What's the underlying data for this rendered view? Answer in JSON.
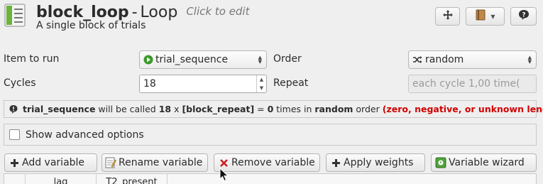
{
  "header": {
    "item_name": "block_loop",
    "separator": "-",
    "item_type": "Loop",
    "edit_hint": "Click to edit",
    "description": "A single block of trials"
  },
  "form": {
    "item_to_run_label": "Item to run",
    "item_to_run_value": "trial_sequence",
    "order_label": "Order",
    "order_value": "random",
    "cycles_label": "Cycles",
    "cycles_value": "18",
    "repeat_label": "Repeat",
    "repeat_value": "each cycle 1,00 time("
  },
  "info": {
    "item": "trial_sequence",
    "text1": " will be called ",
    "cycles": "18",
    "text2": " x ",
    "repeat_var": "[block_repeat]",
    "text3": " = ",
    "total": "0",
    "text4": " times in ",
    "order": "random",
    "text5": " order",
    "warning": "(zero, negative, or unknown length)"
  },
  "advanced": {
    "label": "Show advanced options",
    "checked": false
  },
  "toolbar": {
    "add_variable": "Add variable",
    "rename_variable": "Rename variable",
    "remove_variable": "Remove variable",
    "apply_weights": "Apply weights",
    "variable_wizard": "Variable wizard"
  },
  "table": {
    "columns": [
      "lag",
      "T2_present"
    ]
  }
}
